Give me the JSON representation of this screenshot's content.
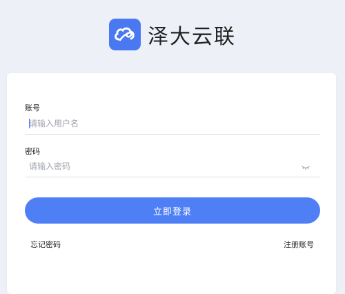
{
  "app": {
    "title": "泽大云联",
    "logo_icon": "cloud-link-icon",
    "accent": "#4a78f0"
  },
  "form": {
    "account_label": "账号",
    "account_placeholder": "请输入用户名",
    "account_value": "",
    "password_label": "密码",
    "password_placeholder": "请输入密码",
    "password_value": "",
    "password_toggle_icon": "eye-closed-icon",
    "submit_label": "立即登录",
    "button_color": "#4f7ff5"
  },
  "links": {
    "forgot_password": "忘记密码",
    "register": "注册账号"
  }
}
